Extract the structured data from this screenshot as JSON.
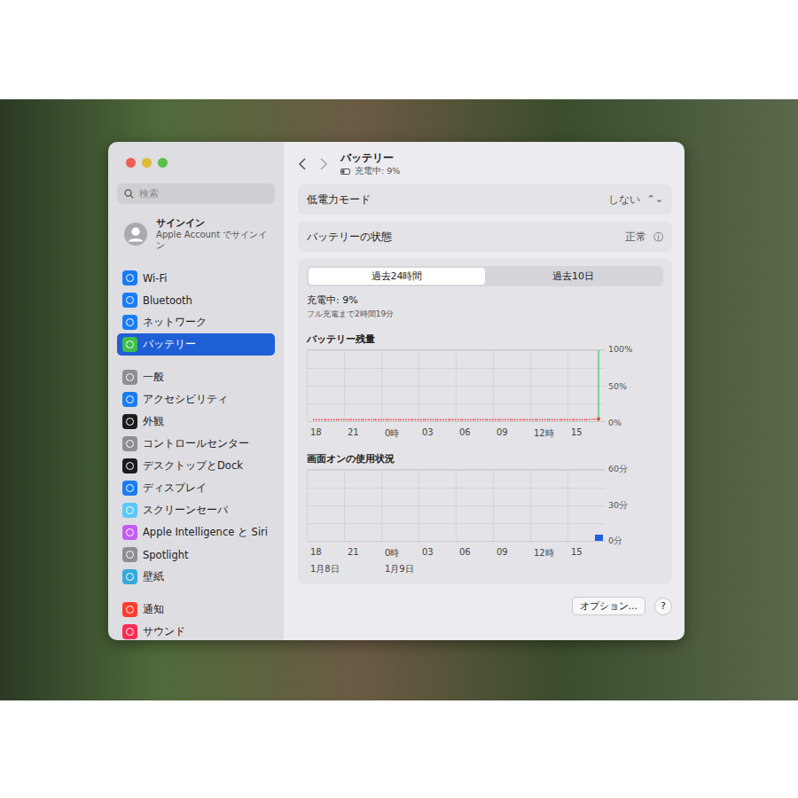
{
  "window": {
    "title": "バッテリー",
    "subtitle": "充電中: 9%"
  },
  "search": {
    "placeholder": "検索"
  },
  "account": {
    "title": "サインイン",
    "subtitle": "Apple Account でサインイン"
  },
  "sidebar": {
    "groups": [
      [
        {
          "label": "Wi-Fi",
          "color": "#1a7cf2",
          "selected": false
        },
        {
          "label": "Bluetooth",
          "color": "#1a7cf2",
          "selected": false
        },
        {
          "label": "ネットワーク",
          "color": "#1a7cf2",
          "selected": false
        },
        {
          "label": "バッテリー",
          "color": "#3fbf4a",
          "selected": true
        }
      ],
      [
        {
          "label": "一般",
          "color": "#8e8e93",
          "selected": false
        },
        {
          "label": "アクセシビリティ",
          "color": "#1a7cf2",
          "selected": false
        },
        {
          "label": "外観",
          "color": "#1c1c1e",
          "selected": false
        },
        {
          "label": "コントロールセンター",
          "color": "#8e8e93",
          "selected": false
        },
        {
          "label": "デスクトップとDock",
          "color": "#1c1c1e",
          "selected": false
        },
        {
          "label": "ディスプレイ",
          "color": "#1a7cf2",
          "selected": false
        },
        {
          "label": "スクリーンセーバ",
          "color": "#5ac8fa",
          "selected": false
        },
        {
          "label": "Apple Intelligence と Siri",
          "color": "#c35df0",
          "selected": false
        },
        {
          "label": "Spotlight",
          "color": "#8e8e93",
          "selected": false
        },
        {
          "label": "壁紙",
          "color": "#34aadc",
          "selected": false
        }
      ],
      [
        {
          "label": "通知",
          "color": "#ff3b30",
          "selected": false
        },
        {
          "label": "サウンド",
          "color": "#ff2d55",
          "selected": false
        }
      ]
    ]
  },
  "settings": [
    {
      "label": "低電力モード",
      "value": "しない",
      "control": "⌃⌄"
    },
    {
      "label": "バッテリーの状態",
      "value": "正常",
      "control": "ⓘ"
    }
  ],
  "tabs": [
    {
      "label": "過去24時間",
      "selected": true
    },
    {
      "label": "過去10日",
      "selected": false
    }
  ],
  "status": {
    "title": "充電中: 9%",
    "detail": "フル充電まで2時間19分"
  },
  "battery_chart": {
    "title": "バッテリー残量",
    "y_ticks": [
      "100%",
      "50%",
      "0%"
    ],
    "x_ticks": [
      "18",
      "21",
      "0時",
      "03",
      "06",
      "09",
      "12時",
      "15"
    ],
    "series": [
      {
        "values": [
          2,
          2,
          2,
          2,
          2,
          2,
          2,
          2,
          2,
          2,
          2,
          2,
          2,
          2,
          2,
          2,
          2,
          2,
          2,
          2,
          2,
          2,
          2,
          3
        ],
        "color": "#e5484d"
      },
      {
        "values": [
          0,
          0,
          0,
          0,
          0,
          0,
          0,
          0,
          0,
          0,
          0,
          0,
          0,
          0,
          0,
          0,
          0,
          0,
          0,
          0,
          0,
          0,
          0,
          100
        ],
        "color": "#34c759"
      }
    ]
  },
  "screen_chart": {
    "title": "画面オンの使用状況",
    "y_ticks": [
      "60分",
      "30分",
      "0分"
    ],
    "x_ticks": [
      "18",
      "21",
      "0時",
      "03",
      "06",
      "09",
      "12時",
      "15"
    ],
    "dates": [
      "1月8日",
      "1月9日"
    ],
    "values": [
      0,
      0,
      0,
      0,
      0,
      0,
      0,
      0,
      0,
      0,
      0,
      0,
      0,
      0,
      0,
      0,
      0,
      0,
      0,
      0,
      0,
      0,
      0,
      5
    ],
    "color": "#1f5fe0"
  },
  "buttons": {
    "options": "オプション...",
    "help": "?"
  }
}
